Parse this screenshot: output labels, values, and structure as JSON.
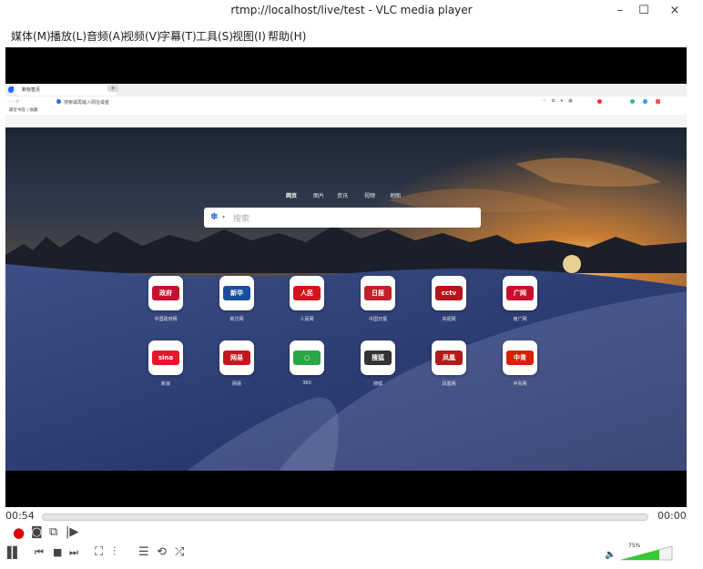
{
  "window": {
    "title": "rtmp://localhost/live/test - VLC media player",
    "minimize": "–",
    "maximize": "☐",
    "close": "×"
  },
  "menu": [
    {
      "label": "媒体(M)"
    },
    {
      "label": "播放(L)"
    },
    {
      "label": "音频(A)"
    },
    {
      "label": "视频(V)"
    },
    {
      "label": "字幕(T)"
    },
    {
      "label": "工具(S)"
    },
    {
      "label": "视图(I)"
    },
    {
      "label": "帮助(H)"
    }
  ],
  "browser": {
    "tab_title": "新标签页",
    "tab_close": "×",
    "new_tab": "+",
    "address": "搜索或再输入网址或者",
    "bookmarks": "最近书签 | 收藏"
  },
  "newtab": {
    "nav": [
      "网页",
      "图片",
      "资讯",
      "视频",
      "地图"
    ],
    "search_placeholder": "搜索",
    "shortcuts": [
      {
        "label": "中国政府网",
        "logo": "政府",
        "color": "#c8102e"
      },
      {
        "label": "新华网",
        "logo": "新华",
        "color": "#1a4fa0"
      },
      {
        "label": "人民网",
        "logo": "人民",
        "color": "#d4121b"
      },
      {
        "label": "中国日报",
        "logo": "日报",
        "color": "#c31f2b"
      },
      {
        "label": "央视网",
        "logo": "cctv",
        "color": "#b5121b"
      },
      {
        "label": "南广网",
        "logo": "广网",
        "color": "#c8102e"
      },
      {
        "label": "新浪",
        "logo": "sina",
        "color": "#e6162d"
      },
      {
        "label": "网易",
        "logo": "网易",
        "color": "#c5171e"
      },
      {
        "label": "360",
        "logo": "○",
        "color": "#28a745"
      },
      {
        "label": "搜狐",
        "logo": "搜狐",
        "color": "#333333"
      },
      {
        "label": "凤凰网",
        "logo": "凤凰",
        "color": "#b31b1b"
      },
      {
        "label": "中青网",
        "logo": "中青",
        "color": "#d81e06"
      }
    ]
  },
  "player": {
    "elapsed": "00:54",
    "remaining": "00:00",
    "position_fraction": 0.0,
    "volume_label": "75%",
    "volume_fraction": 0.75,
    "accent": "#33cc33",
    "record_color": "#e00000"
  },
  "controls": {
    "record": "●",
    "snapshot": "◙",
    "loop_ab": "⧉",
    "frame_step": "|▶",
    "pause": "▌▌",
    "prev": "⏮",
    "stop": "■",
    "next": "⏭",
    "fullscreen": "⛶",
    "ext_settings": "⫶",
    "playlist": "☰",
    "loop": "⟲",
    "shuffle": "⤮"
  }
}
